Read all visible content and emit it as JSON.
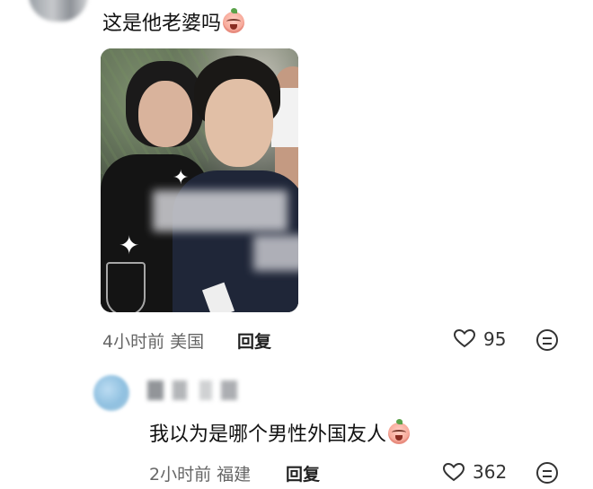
{
  "comment1": {
    "text": "这是他老婆吗",
    "emoji": "crying-laugh-emoji",
    "time": "4小时前",
    "location": "美国",
    "reply_label": "回复",
    "likes": "95",
    "photo_description_icons": [
      "sparkle-icon",
      "sparkle-icon"
    ]
  },
  "comment2": {
    "text": "我以为是哪个男性外国友人",
    "emoji": "crying-laugh-emoji",
    "time": "2小时前",
    "location": "福建",
    "reply_label": "回复",
    "likes": "362"
  },
  "colors": {
    "text": "#111111",
    "meta": "#666666",
    "background": "#ffffff"
  }
}
